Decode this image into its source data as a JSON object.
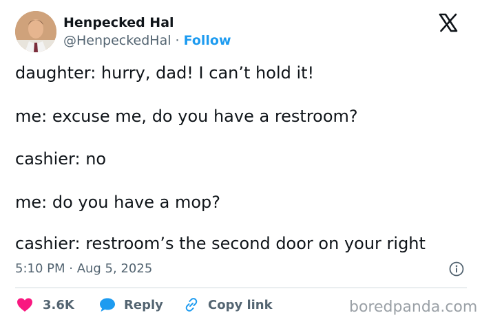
{
  "author": {
    "name": "Henpecked Hal",
    "handle": "@HenpeckedHal",
    "separator": "·",
    "follow_label": "Follow"
  },
  "platform_icon": "x-logo-icon",
  "tweet": {
    "lines": [
      "daughter: hurry, dad! I can’t hold it!",
      "me: excuse me, do you have a restroom?",
      "cashier: no",
      "me: do you have a mop?",
      "cashier: restroom’s the second door on your right"
    ]
  },
  "meta": {
    "timestamp": "5:10 PM · Aug 5, 2025",
    "info_icon": "info-icon"
  },
  "actions": {
    "like_count": "3.6K",
    "reply_label": "Reply",
    "copy_link_label": "Copy link"
  },
  "colors": {
    "like": "#f91880",
    "reply": "#1d9bf0",
    "follow": "#1d9bf0",
    "copy": "#1d9bf0",
    "muted": "#536471"
  },
  "watermark": "boredpanda.com"
}
